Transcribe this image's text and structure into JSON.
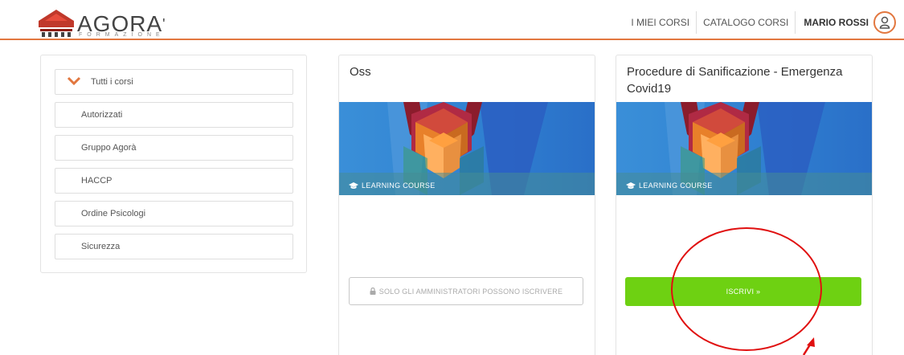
{
  "header": {
    "logo_text": "AGORA",
    "logo_accent": "'",
    "logo_sub": "FORMAZIONE",
    "nav": {
      "my_courses": "I MIEI CORSI",
      "catalog": "CATALOGO CORSI",
      "user_name": "MARIO ROSSI"
    },
    "accent_color": "#e2773f"
  },
  "sidebar": {
    "items": [
      {
        "label": "Tutti i corsi"
      },
      {
        "label": "Autorizzati"
      },
      {
        "label": "Gruppo Agorà"
      },
      {
        "label": "HACCP"
      },
      {
        "label": "Ordine Psicologi"
      },
      {
        "label": "Sicurezza"
      }
    ]
  },
  "courses": [
    {
      "title": "Oss",
      "badge": "LEARNING COURSE",
      "action": "SOLO GLI AMMINISTRATORI POSSONO ISCRIVERE",
      "action_state": "disabled"
    },
    {
      "title": "Procedure di Sanificazione - Emergenza Covid19",
      "badge": "LEARNING COURSE",
      "action": "ISCRIVI »",
      "action_state": "enabled"
    }
  ],
  "colors": {
    "enroll_button": "#6ed112",
    "annotation": "#e01010"
  }
}
